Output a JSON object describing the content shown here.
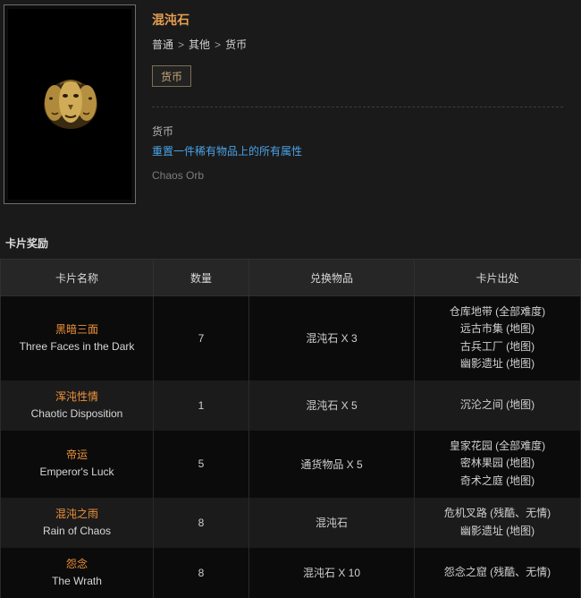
{
  "item": {
    "title": "混沌石",
    "breadcrumb": [
      "普通",
      "其他",
      "货币"
    ],
    "tag": "货币",
    "type": "货币",
    "description": "重置一件稀有物品上的所有属性",
    "english_name": "Chaos Orb",
    "icon": "chaos-orb-icon"
  },
  "section_title": "卡片奖励",
  "table": {
    "headers": [
      "卡片名称",
      "数量",
      "兑换物品",
      "卡片出处"
    ],
    "rows": [
      {
        "name_cn": "黑暗三面",
        "name_en": "Three Faces in the Dark",
        "qty": "7",
        "reward": "混沌石 X 3",
        "sources": [
          "仓库地带 (全部难度)",
          "远古市集 (地图)",
          "古兵工厂 (地图)",
          "幽影遗址 (地图)"
        ]
      },
      {
        "name_cn": "浑沌性情",
        "name_en": "Chaotic Disposition",
        "qty": "1",
        "reward": "混沌石 X 5",
        "sources": [
          "沉沦之间 (地图)"
        ]
      },
      {
        "name_cn": "帝运",
        "name_en": "Emperor's Luck",
        "qty": "5",
        "reward": "通货物品 X 5",
        "sources": [
          "皇家花园 (全部难度)",
          "密林果园 (地图)",
          "奇术之庭 (地图)"
        ]
      },
      {
        "name_cn": "混沌之雨",
        "name_en": "Rain of Chaos",
        "qty": "8",
        "reward": "混沌石",
        "sources": [
          "危机叉路 (残酷、无情)",
          "幽影遗址 (地图)"
        ]
      },
      {
        "name_cn": "怨念",
        "name_en": "The Wrath",
        "qty": "8",
        "reward": "混沌石 X 10",
        "sources": [
          "怨念之窟 (残酷、无情)"
        ]
      }
    ]
  }
}
